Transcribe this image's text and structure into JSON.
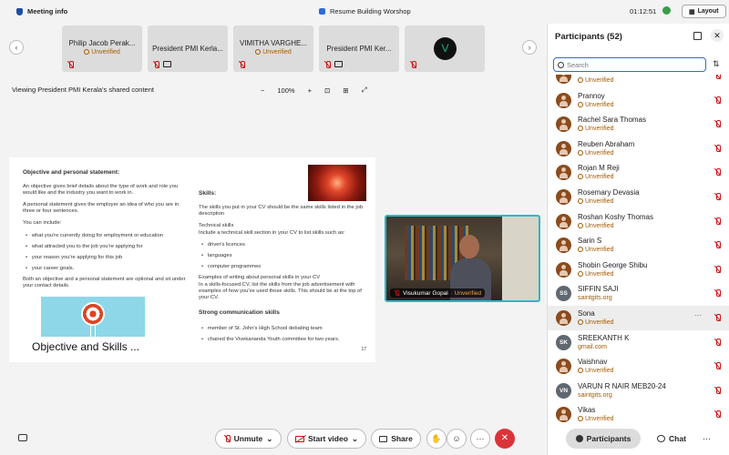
{
  "topbar": {
    "meeting_info": "Meeting info",
    "meeting_title": "Resume Building Worshop",
    "clock": "01:12:51",
    "layout_label": "Layout"
  },
  "strip": {
    "tiles": [
      {
        "name": "Philip Jacob Perak...",
        "status": "Unverified"
      },
      {
        "name": "President PMI Kerla...",
        "status": ""
      },
      {
        "name": "VIMITHA VARGHE...",
        "status": "Unverified"
      },
      {
        "name": "President PMI Ker...",
        "status": ""
      }
    ],
    "avatar_initial": "V"
  },
  "share": {
    "viewing_label": "Viewing President PMI Kerala's shared content",
    "zoom_minus": "−",
    "zoom": "100%",
    "zoom_plus": "+"
  },
  "slide": {
    "heading1": "Objective and personal statement:",
    "p1": "An objective gives brief details about the type of work and role you would like and the industry you want to work in.",
    "p2": "A personal statement gives the employer an idea of who you are in three or four sentences.",
    "p3": "You can include:",
    "bullets1": [
      "what you're currently doing for employment or education",
      "what attracted you to the job you're applying for",
      "your reason you're applying for this job",
      "your career goals."
    ],
    "p4": "Both an objective and a personal statement are optional and sit under your contact details.",
    "skills_heading": "Skills:",
    "skills_p": "The skills you put in your CV should be the same skills listed in the job description",
    "tech_heading": "Technical skills",
    "tech_p": "Include a technical skill section in your CV to list skills such as:",
    "bullets2": [
      "driver's licences",
      "languages",
      "computer programmes"
    ],
    "examples_p": "Examples of writing about personal skills in your CV",
    "examples_p2": "In a skills-focused CV, list the skills from the job advertisement with examples of how you've used those skills. This should be at the top of your CV.",
    "comm_heading": "Strong communication skills",
    "bullets3": [
      "member of St. John's High School debating team",
      "chaired the Vivekananda Youth committee for two years."
    ],
    "title": "Objective and Skills ...",
    "page_num": "17"
  },
  "video": {
    "name": "Visukumar Gopal",
    "status": "Unverified"
  },
  "panel": {
    "title": "Participants (52)",
    "search_placeholder": "Search",
    "participants": [
      {
        "name": "",
        "sub": "Unverified",
        "av": "",
        "gray": false
      },
      {
        "name": "Prannoy",
        "sub": "Unverified",
        "av": "",
        "gray": false
      },
      {
        "name": "Rachel Sara Thomas",
        "sub": "Unverified",
        "av": "",
        "gray": false
      },
      {
        "name": "Reuben Abraham",
        "sub": "Unverified",
        "av": "",
        "gray": false
      },
      {
        "name": "Rojan M Reji",
        "sub": "Unverified",
        "av": "",
        "gray": false
      },
      {
        "name": "Rosemary Devasia",
        "sub": "Unverified",
        "av": "",
        "gray": false
      },
      {
        "name": "Roshan Koshy Thomas",
        "sub": "Unverified",
        "av": "",
        "gray": false
      },
      {
        "name": "Sarin S",
        "sub": "Unverified",
        "av": "",
        "gray": false
      },
      {
        "name": "Shobin George Shibu",
        "sub": "Unverified",
        "av": "",
        "gray": false
      },
      {
        "name": "SIFFIN SAJI",
        "sub": "saintgits.org",
        "av": "SS",
        "gray": true
      },
      {
        "name": "Sona",
        "sub": "Unverified",
        "av": "",
        "gray": false,
        "hl": true
      },
      {
        "name": "SREEKANTH K",
        "sub": "gmail.com",
        "av": "SK",
        "gray": true
      },
      {
        "name": "Vaishnav",
        "sub": "Unverified",
        "av": "",
        "gray": false
      },
      {
        "name": "VARUN R NAIR MEB20-24",
        "sub": "saintgits.org",
        "av": "VN",
        "gray": true
      },
      {
        "name": "Vikas",
        "sub": "Unverified",
        "av": "",
        "gray": false
      }
    ],
    "more": "···"
  },
  "controls": {
    "unmute": "Unmute",
    "start_video": "Start video",
    "share": "Share",
    "more": "···",
    "leave": "✕",
    "participants_tab": "Participants",
    "chat_tab": "Chat",
    "panel_more": "···"
  }
}
